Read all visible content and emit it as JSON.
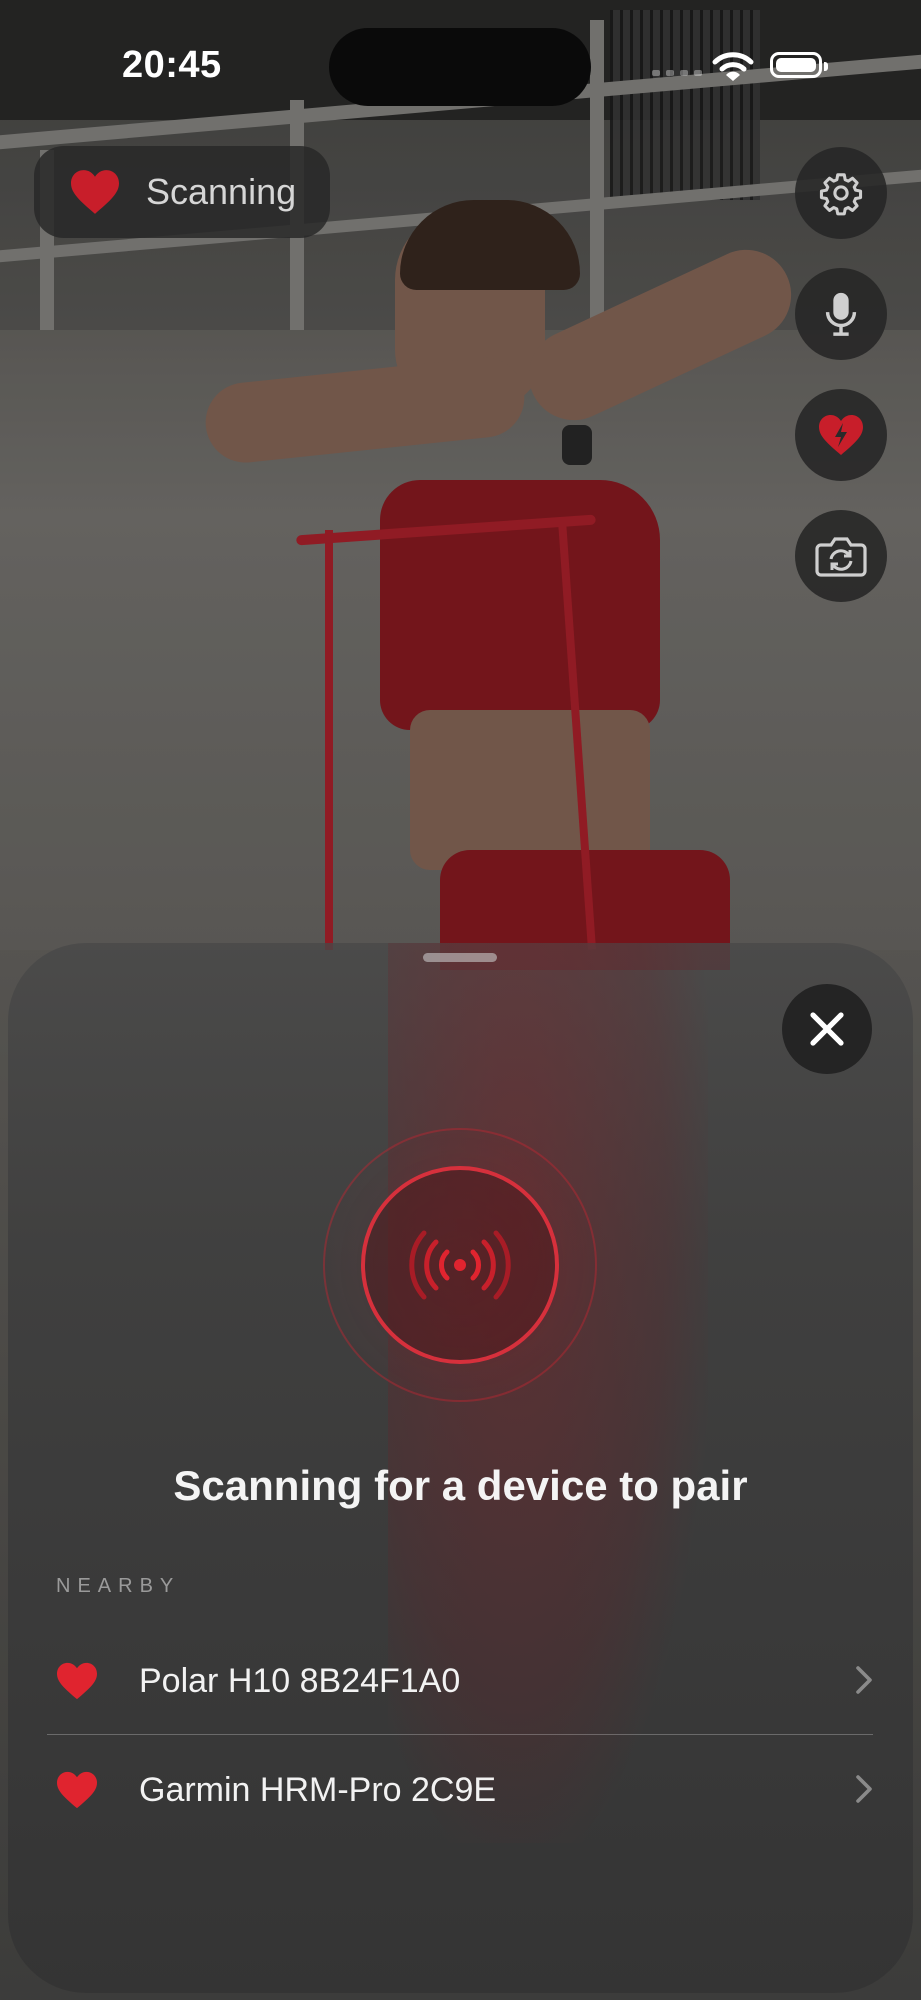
{
  "status_bar": {
    "time": "20:45"
  },
  "scan_pill": {
    "label": "Scanning",
    "icon": "heart-icon"
  },
  "side_buttons": [
    {
      "name": "settings",
      "icon": "gear-icon"
    },
    {
      "name": "microphone",
      "icon": "microphone-icon"
    },
    {
      "name": "heart-rate",
      "icon": "heart-bolt-icon"
    },
    {
      "name": "switch-camera",
      "icon": "camera-rotate-icon"
    }
  ],
  "sheet": {
    "title": "Scanning for a device to pair",
    "section_label": "NEARBY",
    "devices": [
      {
        "name": "Polar H10 8B24F1A0",
        "icon": "heart-icon"
      },
      {
        "name": "Garmin HRM-Pro 2C9E",
        "icon": "heart-icon"
      }
    ]
  },
  "colors": {
    "accent_red": "#E0242F",
    "sheet_bg": "#3A3A3A",
    "button_bg": "#262626",
    "text_primary": "#F2F2F2",
    "text_secondary": "#9A9A9A"
  }
}
